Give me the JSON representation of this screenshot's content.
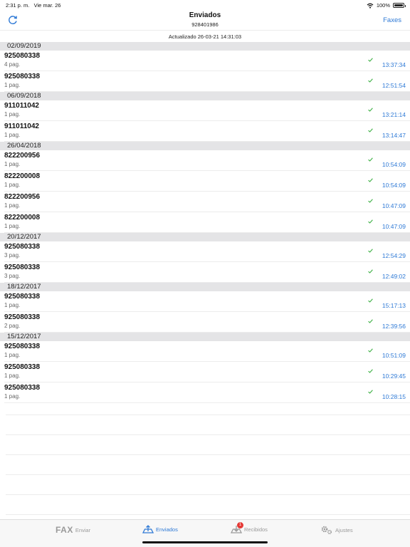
{
  "status": {
    "time": "2:31 p. m.",
    "date": "Vie mar. 26",
    "battery": "100%"
  },
  "nav": {
    "title": "Enviados",
    "subtitle": "928401986",
    "right_button": "Faxes",
    "refresh_icon": "refresh-icon"
  },
  "updated": "Actualizado 26-03-21 14:31:03",
  "sections": [
    {
      "date": "02/09/2019",
      "rows": [
        {
          "number": "925080338",
          "pages": "4 pag.",
          "time": "13:37:34"
        },
        {
          "number": "925080338",
          "pages": "1 pag.",
          "time": "12:51:54"
        }
      ]
    },
    {
      "date": "06/09/2018",
      "rows": [
        {
          "number": "911011042",
          "pages": "1 pag.",
          "time": "13:21:14"
        },
        {
          "number": "911011042",
          "pages": "1 pag.",
          "time": "13:14:47"
        }
      ]
    },
    {
      "date": "26/04/2018",
      "rows": [
        {
          "number": "822200956",
          "pages": "1 pag.",
          "time": "10:54:09"
        },
        {
          "number": "822200008",
          "pages": "1 pag.",
          "time": "10:54:09"
        },
        {
          "number": "822200956",
          "pages": "1 pag.",
          "time": "10:47:09"
        },
        {
          "number": "822200008",
          "pages": "1 pag.",
          "time": "10:47:09"
        }
      ]
    },
    {
      "date": "20/12/2017",
      "rows": [
        {
          "number": "925080338",
          "pages": "3 pag.",
          "time": "12:54:29"
        },
        {
          "number": "925080338",
          "pages": "3 pag.",
          "time": "12:49:02"
        }
      ]
    },
    {
      "date": "18/12/2017",
      "rows": [
        {
          "number": "925080338",
          "pages": "1 pag.",
          "time": "15:17:13"
        },
        {
          "number": "925080338",
          "pages": "2 pag.",
          "time": "12:39:56"
        }
      ]
    },
    {
      "date": "15/12/2017",
      "rows": [
        {
          "number": "925080338",
          "pages": "1 pag.",
          "time": "10:51:09"
        },
        {
          "number": "925080338",
          "pages": "1 pag.",
          "time": "10:29:45"
        },
        {
          "number": "925080338",
          "pages": "1 pag.",
          "time": "10:28:15"
        }
      ]
    }
  ],
  "tabs": [
    {
      "logo": "FAX",
      "label": "Enviar",
      "icon": "fax-logo-icon",
      "active": false
    },
    {
      "label": "Enviados",
      "icon": "sent-tray-icon",
      "active": true
    },
    {
      "label": "Recibidos",
      "icon": "inbox-tray-icon",
      "active": false,
      "badge": "1"
    },
    {
      "label": "Ajustes",
      "icon": "gear-icon",
      "active": false
    }
  ],
  "colors": {
    "accent": "#2f7ad6",
    "check": "#3cb043",
    "section_bg": "#e4e4e6",
    "badge": "#e53935"
  }
}
